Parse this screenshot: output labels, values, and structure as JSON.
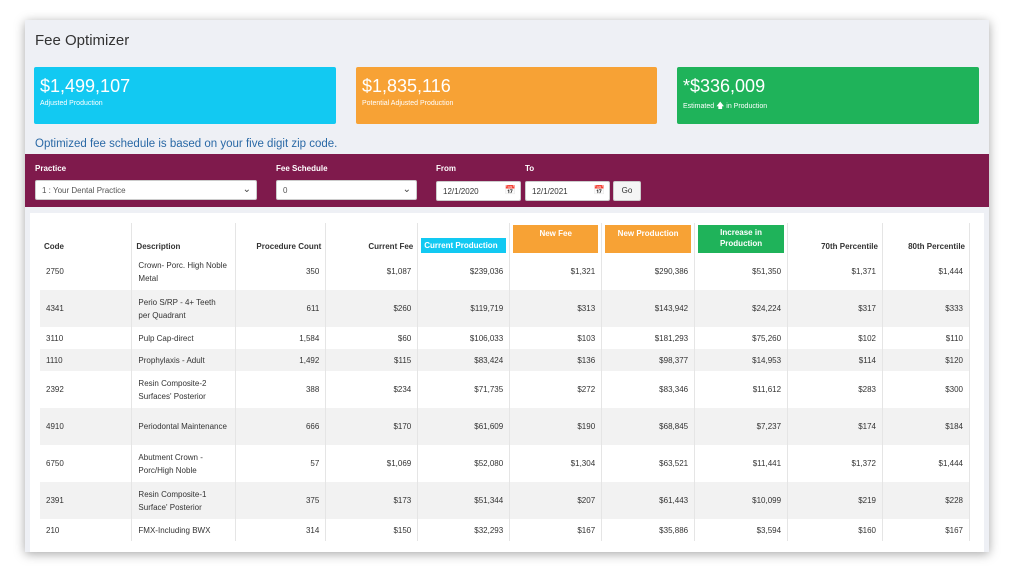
{
  "title": "Fee Optimizer",
  "cards": {
    "adjusted": {
      "value": "$1,499,107",
      "label": "Adjusted Production"
    },
    "potential": {
      "value": "$1,835,116",
      "label": "Potential Adjusted Production"
    },
    "estimated": {
      "value": "*$336,009",
      "label_pre": "Estimated",
      "label_post": "in Production",
      "icon": "arrow-up-icon"
    }
  },
  "note": "Optimized fee schedule is based on your five digit zip code.",
  "filters": {
    "practice_label": "Practice",
    "practice_value": "1 : Your Dental Practice",
    "fee_schedule_label": "Fee Schedule",
    "fee_schedule_value": "0",
    "from_label": "From",
    "from_value": "12/1/2020",
    "to_label": "To",
    "to_value": "12/1/2021",
    "go_label": "Go"
  },
  "table": {
    "headers": [
      "Code",
      "Description",
      "Procedure Count",
      "Current Fee",
      "Current Production",
      "New Fee",
      "New Production",
      "Increase in Production",
      "70th Percentile",
      "80th Percentile"
    ],
    "rows": [
      [
        "2750",
        "Crown- Porc. High Noble Metal",
        "350",
        "$1,087",
        "$239,036",
        "$1,321",
        "$290,386",
        "$51,350",
        "$1,371",
        "$1,444"
      ],
      [
        "4341",
        "Perio S/RP - 4+ Teeth per Quadrant",
        "611",
        "$260",
        "$119,719",
        "$313",
        "$143,942",
        "$24,224",
        "$317",
        "$333"
      ],
      [
        "3110",
        "Pulp Cap-direct",
        "1,584",
        "$60",
        "$106,033",
        "$103",
        "$181,293",
        "$75,260",
        "$102",
        "$110"
      ],
      [
        "1110",
        "Prophylaxis - Adult",
        "1,492",
        "$115",
        "$83,424",
        "$136",
        "$98,377",
        "$14,953",
        "$114",
        "$120"
      ],
      [
        "2392",
        "Resin Composite-2 Surfaces' Posterior",
        "388",
        "$234",
        "$71,735",
        "$272",
        "$83,346",
        "$11,612",
        "$283",
        "$300"
      ],
      [
        "4910",
        "Periodontal Maintenance",
        "666",
        "$170",
        "$61,609",
        "$190",
        "$68,845",
        "$7,237",
        "$174",
        "$184"
      ],
      [
        "6750",
        "Abutment Crown - Porc/High Noble",
        "57",
        "$1,069",
        "$52,080",
        "$1,304",
        "$63,521",
        "$11,441",
        "$1,372",
        "$1,444"
      ],
      [
        "2391",
        "Resin Composite-1 Surface' Posterior",
        "375",
        "$173",
        "$51,344",
        "$207",
        "$61,443",
        "$10,099",
        "$219",
        "$228"
      ],
      [
        "210",
        "FMX-Including BWX",
        "314",
        "$150",
        "$32,293",
        "$167",
        "$35,886",
        "$3,594",
        "$160",
        "$167"
      ]
    ]
  }
}
